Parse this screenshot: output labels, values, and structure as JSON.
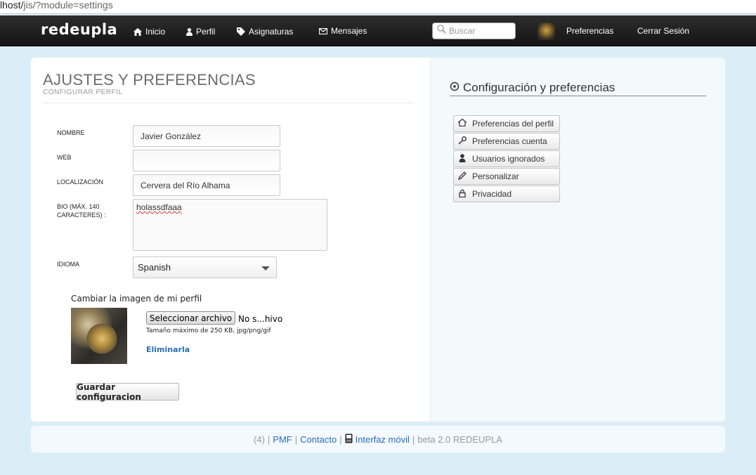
{
  "browser": {
    "url_host": "lhost/",
    "url_path": "jis/?module=settings"
  },
  "topbar": {
    "logo": "redeupla",
    "nav": [
      {
        "label": "Inicio",
        "icon": "home-icon"
      },
      {
        "label": "Perfil",
        "icon": "user-icon"
      },
      {
        "label": "Asignaturas",
        "icon": "tag-icon"
      },
      {
        "label": "Mensajes",
        "icon": "mail-icon"
      }
    ],
    "search_placeholder": "Buscar",
    "preferences_label": "Preferencias",
    "logout_label": "Cerrar Sesión"
  },
  "page": {
    "title": "AJUSTES Y PREFERENCIAS",
    "subtitle": "CONFIGURAR PERFIL"
  },
  "form": {
    "name_label": "NOMBRE",
    "name_value": "Javier González",
    "web_label": "WEB",
    "web_value": "",
    "location_label": "LOCALIZACIÓN",
    "location_value": "Cervera del Río Alhama",
    "bio_label": "BIO (MÁX. 140 CARACTERES) :",
    "bio_value": "holassdfaaa",
    "language_label": "IDIOMA",
    "language_value": "Spanish",
    "image_heading": "Cambiar la imagen de mi perfil",
    "file_button": "Seleccionar archivo",
    "file_status": "No s...hivo",
    "file_hint": "Tamaño máximo de 250 KB, jpg/png/gif",
    "delete_link": "Eliminarla",
    "save_button": "Guardar configuracion"
  },
  "sidebar": {
    "heading": "Configuración y preferencias",
    "items": [
      {
        "label": "Preferencias del perfil",
        "icon": "home-icon"
      },
      {
        "label": "Preferencias cuenta",
        "icon": "key-icon"
      },
      {
        "label": "Usuarios ignorados",
        "icon": "user-icon"
      },
      {
        "label": "Personalizar",
        "icon": "pencil-icon"
      },
      {
        "label": "Privacidad",
        "icon": "lock-icon"
      }
    ]
  },
  "footer": {
    "count": "(4)",
    "pmf": "PMF",
    "contact": "Contacto",
    "mobile": "Interfaz móvil",
    "version": "beta 2.0 REDEUPLA"
  }
}
